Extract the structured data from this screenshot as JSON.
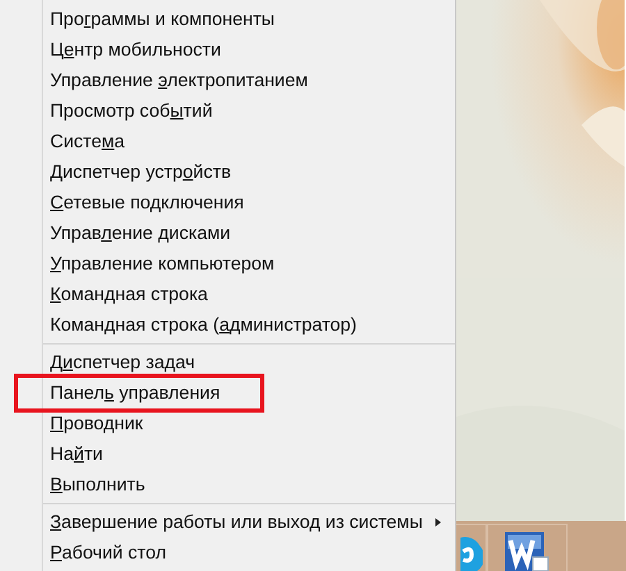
{
  "menu": {
    "groups": [
      {
        "items": [
          {
            "before": "Про",
            "key": "г",
            "after": "раммы и компоненты",
            "has_submenu": false,
            "highlighted": false
          },
          {
            "before": "Ц",
            "key": "е",
            "after": "нтр мобильности",
            "has_submenu": false,
            "highlighted": false
          },
          {
            "before": "Управление ",
            "key": "э",
            "after": "лектропитанием",
            "has_submenu": false,
            "highlighted": false
          },
          {
            "before": "Просмотр соб",
            "key": "ы",
            "after": "тий",
            "has_submenu": false,
            "highlighted": false
          },
          {
            "before": "Систе",
            "key": "м",
            "after": "а",
            "has_submenu": false,
            "highlighted": false
          },
          {
            "before": "Диспетчер устр",
            "key": "о",
            "after": "йств",
            "has_submenu": false,
            "highlighted": false
          },
          {
            "key": "С",
            "after": "етевые подключения",
            "has_submenu": false,
            "highlighted": false
          },
          {
            "before": "Управ",
            "key": "л",
            "after": "ение дисками",
            "has_submenu": false,
            "highlighted": false
          },
          {
            "key": "У",
            "after": "правление компьютером",
            "has_submenu": false,
            "highlighted": false
          },
          {
            "key": "К",
            "after": "омандная строка",
            "has_submenu": false,
            "highlighted": false
          },
          {
            "before": "Командная строка (",
            "key": "а",
            "after": "дминистратор)",
            "has_submenu": false,
            "highlighted": false
          }
        ]
      },
      {
        "items": [
          {
            "before": "Д",
            "key": "и",
            "after": "спетчер задач",
            "has_submenu": false,
            "highlighted": false
          },
          {
            "before": "Панел",
            "key": "ь",
            "after": " управления",
            "has_submenu": false,
            "highlighted": true
          },
          {
            "key": "П",
            "after": "роводник",
            "has_submenu": false,
            "highlighted": false
          },
          {
            "before": "На",
            "key": "й",
            "after": "ти",
            "has_submenu": false,
            "highlighted": false
          },
          {
            "key": "В",
            "after": "ыполнить",
            "has_submenu": false,
            "highlighted": false
          }
        ]
      },
      {
        "items": [
          {
            "key": "З",
            "after": "авершение работы или выход из системы",
            "has_submenu": true,
            "highlighted": false
          },
          {
            "key": "Р",
            "after": "абочий стол",
            "has_submenu": false,
            "highlighted": false
          }
        ]
      }
    ]
  },
  "taskbar": {
    "apps": [
      {
        "kind": "skype"
      },
      {
        "kind": "word"
      }
    ]
  }
}
